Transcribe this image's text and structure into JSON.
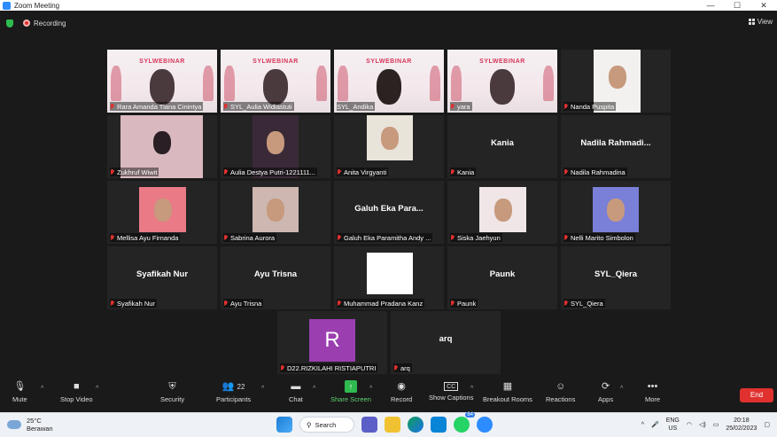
{
  "window": {
    "title": "Zoom Meeting",
    "controls": [
      "—",
      "☐",
      "✕"
    ]
  },
  "topbar": {
    "recording_label": "Recording",
    "view_label": "View"
  },
  "tiles": [
    {
      "name": "Rara Amanda Tiana Cinintya",
      "muted": true,
      "kind": "video-banner"
    },
    {
      "name": "SYL_Aulia Widiastuti",
      "muted": true,
      "kind": "video-banner"
    },
    {
      "name": "SYL_Andika",
      "muted": false,
      "kind": "video-banner",
      "active": true
    },
    {
      "name": "yara",
      "muted": true,
      "kind": "video-banner"
    },
    {
      "name": "Nanda Puspita",
      "muted": true,
      "kind": "video"
    },
    {
      "name": "Zukhruf Wiwit",
      "muted": true,
      "kind": "video"
    },
    {
      "name": "Aulia Destya Putri-1221111...",
      "muted": true,
      "kind": "video"
    },
    {
      "name": "Anita Virgyanti",
      "muted": true,
      "kind": "video"
    },
    {
      "name": "Kania",
      "muted": true,
      "kind": "text",
      "big": "Kania"
    },
    {
      "name": "Nadila Rahmadina",
      "muted": true,
      "kind": "text",
      "big": "Nadila  Rahmadi..."
    },
    {
      "name": "Mellisa Ayu Firnanda",
      "muted": true,
      "kind": "video"
    },
    {
      "name": "Sabrina Aurora",
      "muted": true,
      "kind": "video"
    },
    {
      "name": "Galuh Eka Paramitha Andy ...",
      "muted": true,
      "kind": "text",
      "big": "Galuh  Eka  Para..."
    },
    {
      "name": "Siska Jaehyun",
      "muted": true,
      "kind": "video"
    },
    {
      "name": "Nelli Marito Simbolon",
      "muted": true,
      "kind": "video"
    },
    {
      "name": "Syafikah Nur",
      "muted": true,
      "kind": "text",
      "big": "Syafikah Nur"
    },
    {
      "name": "Ayu Trisna",
      "muted": true,
      "kind": "text",
      "big": "Ayu Trisna"
    },
    {
      "name": "Muhammad Pradana Kanz",
      "muted": true,
      "kind": "video"
    },
    {
      "name": "Paunk",
      "muted": true,
      "kind": "text",
      "big": "Paunk"
    },
    {
      "name": "SYL_Qiera",
      "muted": true,
      "kind": "text",
      "big": "SYL_Qiera"
    },
    {
      "name": "D22.RIZKILAHI RISTIAPUTRI",
      "muted": true,
      "kind": "avatar",
      "avatar_letter": "R",
      "avatar_color": "#9b3fb0"
    },
    {
      "name": "arq",
      "muted": true,
      "kind": "text",
      "big": "arq"
    }
  ],
  "banner_text": "SYLWEBINAR",
  "toolbar": {
    "mute": "Mute",
    "stop_video": "Stop Video",
    "security": "Security",
    "participants": "Participants",
    "participants_count": "22",
    "chat": "Chat",
    "share_screen": "Share Screen",
    "record": "Record",
    "show_captions": "Show Captions",
    "breakout_rooms": "Breakout Rooms",
    "reactions": "Reactions",
    "apps": "Apps",
    "more": "More",
    "end": "End",
    "cc_icon_text": "CC"
  },
  "taskbar": {
    "temperature": "25°C",
    "weather": "Berawan",
    "search": "Search",
    "whatsapp_badge": "84",
    "language": "ENG",
    "region": "US",
    "time": "20:18",
    "date": "25/02/2023"
  },
  "colors": {
    "accent_green": "#2fbb4f",
    "end_red": "#e0312e",
    "active_speaker": "#c8e05a"
  }
}
